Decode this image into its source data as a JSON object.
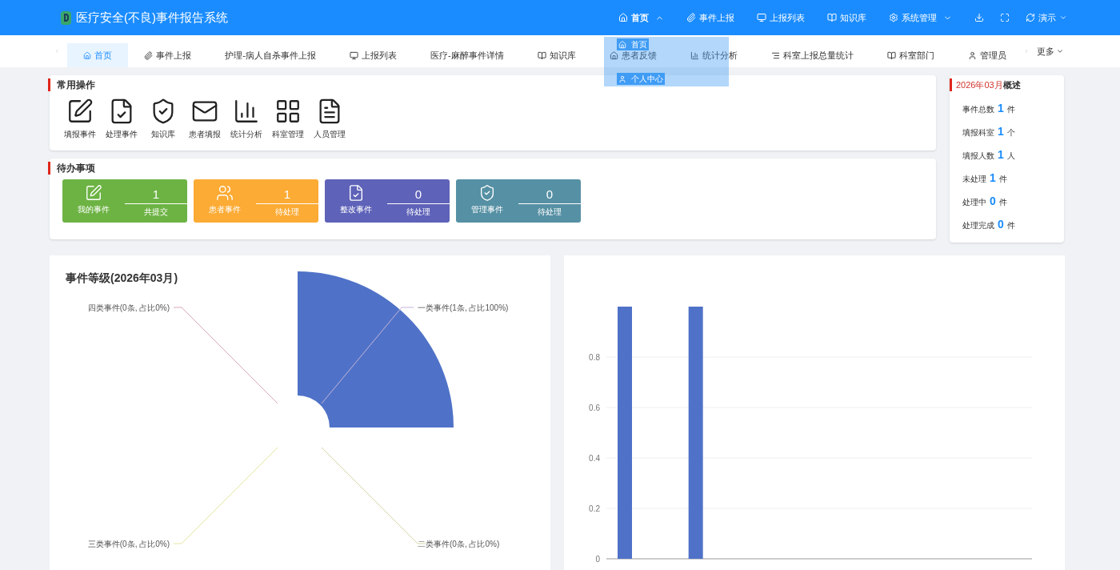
{
  "header": {
    "title": "医疗安全(不良)事件报告系统",
    "nav": [
      {
        "label": "首页",
        "expanded": true
      },
      {
        "label": "事件上报",
        "expanded": false
      },
      {
        "label": "上报列表",
        "expanded": false
      },
      {
        "label": "知识库",
        "expanded": false
      },
      {
        "label": "系统管理",
        "expanded": false
      }
    ],
    "user": {
      "label": "演示"
    }
  },
  "dropdown_menu": {
    "items": [
      {
        "label": "首页"
      },
      {
        "label": "个人中心"
      }
    ]
  },
  "tabs": [
    {
      "label": "首页",
      "selected": true
    },
    {
      "label": "事件上报",
      "selected": false
    },
    {
      "label": "护理-病人自杀事件上报",
      "selected": false
    },
    {
      "label": "上报列表",
      "selected": false
    },
    {
      "label": "医疗-麻醉事件详情",
      "selected": false
    },
    {
      "label": "知识库",
      "selected": false
    },
    {
      "label": "患者反馈",
      "selected": false
    },
    {
      "label": "统计分析",
      "selected": false
    },
    {
      "label": "科室上报总量统计",
      "selected": false
    },
    {
      "label": "科室部门",
      "selected": false
    },
    {
      "label": "管理员",
      "selected": false
    }
  ],
  "more": "更多",
  "quick_actions": {
    "title": "常用操作",
    "items": [
      {
        "label": "填报事件"
      },
      {
        "label": "处理事件"
      },
      {
        "label": "知识库"
      },
      {
        "label": "患者填报"
      },
      {
        "label": "统计分析"
      },
      {
        "label": "科室管理"
      },
      {
        "label": "人员管理"
      }
    ]
  },
  "todo": {
    "title": "待办事项",
    "cards": [
      {
        "label": "我的事件",
        "count": "1",
        "caption": "共提交",
        "color": "#6db344"
      },
      {
        "label": "患者事件",
        "count": "1",
        "caption": "待处理",
        "color": "#fcab35"
      },
      {
        "label": "整改事件",
        "count": "0",
        "caption": "待处理",
        "color": "#5e62b8"
      },
      {
        "label": "管理事件",
        "count": "0",
        "caption": "待处理",
        "color": "#5690a4"
      }
    ]
  },
  "overview": {
    "period": "2026年03月",
    "title": "概述",
    "rows": [
      {
        "label": "事件总数",
        "value": "1",
        "unit": "件"
      },
      {
        "label": "填报科室",
        "value": "1",
        "unit": "个"
      },
      {
        "label": "填报人数",
        "value": "1",
        "unit": "人"
      },
      {
        "label": "未处理",
        "value": "1",
        "unit": "件"
      },
      {
        "label": "处理中",
        "value": "0",
        "unit": "件"
      },
      {
        "label": "处理完成",
        "value": "0",
        "unit": "件"
      }
    ]
  },
  "level_chart": {
    "title": "事件等级(2026年03月)",
    "chart_data": {
      "type": "pie",
      "categories": [
        "一类事件(1条, 占比100%)",
        "二类事件(0条, 占比0%)",
        "三类事件(0条, 占比0%)",
        "四类事件(0条, 占比0%)"
      ],
      "values": [
        1,
        0,
        0,
        0
      ]
    }
  },
  "trend_chart": {
    "chart_data": {
      "type": "bar",
      "values": [
        1,
        0,
        1,
        0,
        0,
        0,
        0,
        0,
        0,
        0,
        0,
        0
      ],
      "ylim": [
        0,
        1
      ],
      "grid": true,
      "yticks": [
        0,
        0.2,
        0.4,
        0.6,
        0.8
      ]
    }
  }
}
